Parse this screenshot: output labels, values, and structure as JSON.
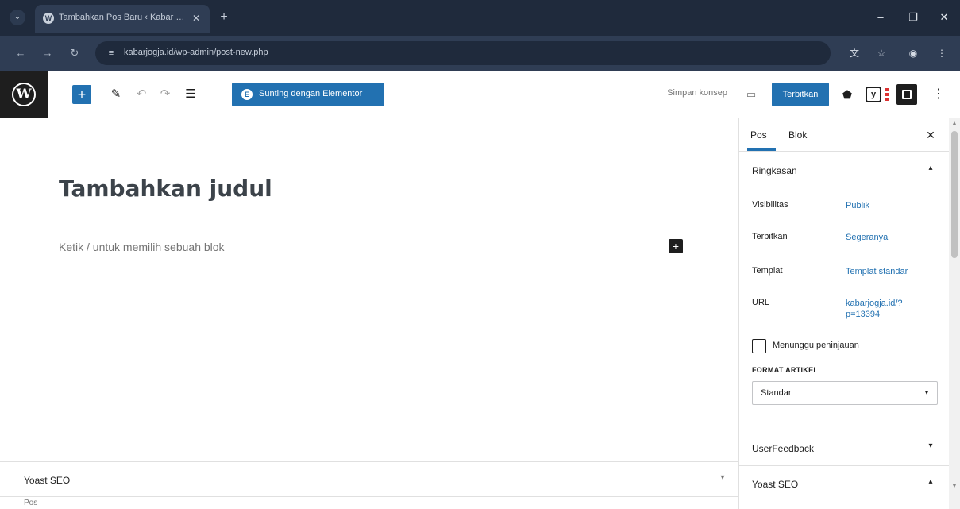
{
  "browser": {
    "tab_title": "Tambahkan Pos Baru ‹ Kabar J…",
    "tab_close": "✕",
    "new_tab": "+",
    "url": "kabarjogja.id/wp-admin/post-new.php",
    "window_minimize": "–",
    "window_restore": "❐",
    "window_close": "✕"
  },
  "editor_header": {
    "elementor_label": "Sunting dengan Elementor",
    "save_draft": "Simpan konsep",
    "publish": "Terbitkan"
  },
  "canvas": {
    "title_placeholder": "Tambahkan judul",
    "block_placeholder": "Ketik / untuk memilih sebuah blok"
  },
  "sidebar": {
    "tab_post": "Pos",
    "tab_block": "Blok",
    "summary": {
      "title": "Ringkasan",
      "rows": [
        {
          "label": "Visibilitas",
          "value": "Publik"
        },
        {
          "label": "Terbitkan",
          "value": "Segeranya"
        },
        {
          "label": "Templat",
          "value": "Templat standar"
        },
        {
          "label": "URL",
          "value": "kabarjogja.id/?p=13394"
        }
      ],
      "pending_review": "Menunggu peninjauan",
      "post_format_label": "FORMAT ARTIKEL",
      "post_format_value": "Standar"
    },
    "panels": [
      {
        "title": "UserFeedback"
      },
      {
        "title": "Yoast SEO"
      }
    ]
  },
  "metabox": {
    "title": "Yoast SEO"
  },
  "status_bar": {
    "breadcrumb": "Pos"
  },
  "colors": {
    "accent": "#2271b1",
    "chrome_dark": "#1f2a3c",
    "wp_dark": "#1e1e1e",
    "yoast_score": "#dc3232"
  }
}
